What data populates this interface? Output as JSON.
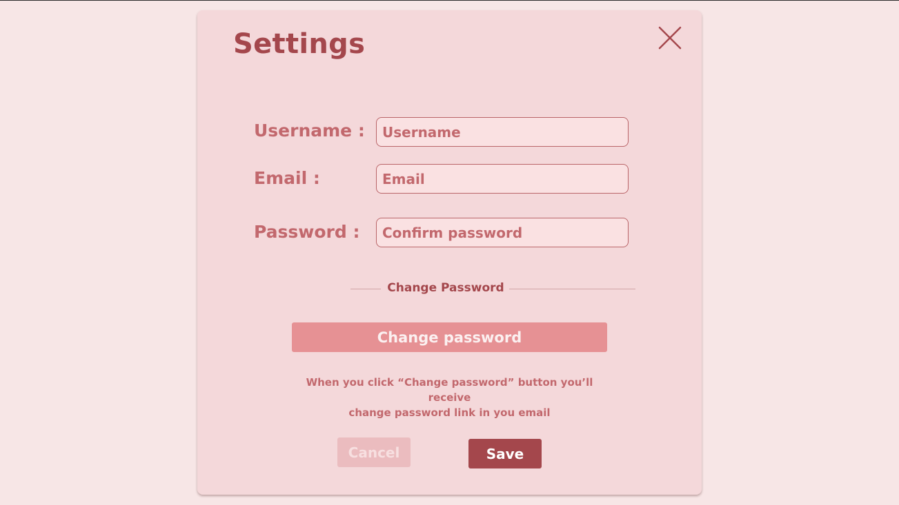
{
  "colors": {
    "page_background": "#f7e6e6",
    "dialog_background": "#f4d8da",
    "accent": "#a4474c",
    "label_text": "#c2686d",
    "input_background": "#fae1e2",
    "change_button": "#e69194",
    "cancel_button": "#ebbcbf"
  },
  "dialog": {
    "title": "Settings",
    "close_icon": "close-icon"
  },
  "form": {
    "username": {
      "label": "Username :",
      "placeholder": "Username",
      "value": ""
    },
    "email": {
      "label": "Email :",
      "placeholder": "Email",
      "value": ""
    },
    "password": {
      "label": "Password :",
      "placeholder": "Confirm password",
      "value": ""
    }
  },
  "change_password": {
    "divider_label": "Change Password",
    "button_label": "Change password",
    "note_line1": "When you click “Change password” button you’ll receive",
    "note_line2": "change password link in you email"
  },
  "actions": {
    "cancel_label": "Cancel",
    "save_label": "Save"
  }
}
